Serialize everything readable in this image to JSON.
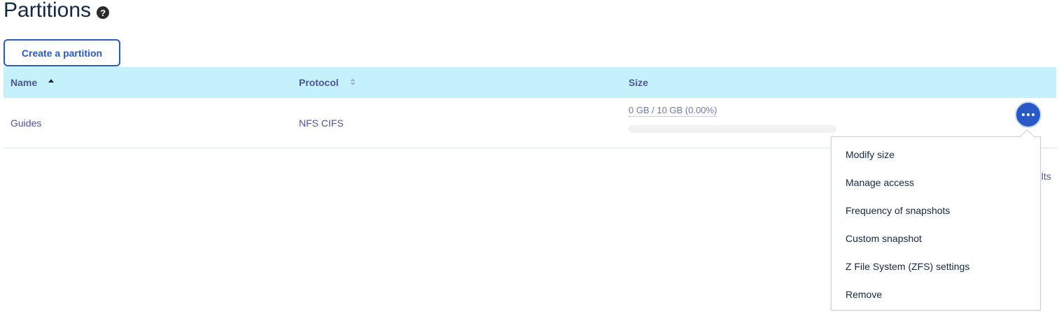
{
  "header": {
    "title": "Partitions",
    "help_icon": "question-circle-icon",
    "create_button": "Create a partition"
  },
  "table": {
    "columns": [
      {
        "label": "Name",
        "sort": "ascending"
      },
      {
        "label": "Protocol",
        "sort": "none"
      },
      {
        "label": "Size",
        "sort": null
      }
    ],
    "rows": [
      {
        "name": "Guides",
        "protocol": "NFS CIFS",
        "size_text": "0 GB / 10 GB (0.00%)",
        "usage_fraction": 0.0
      }
    ],
    "actions_icon": "ellipsis-icon"
  },
  "pagination": {
    "results_fragment": "ults"
  },
  "actions_menu": {
    "items": [
      "Modify size",
      "Manage access",
      "Frequency of snapshots",
      "Custom snapshot",
      "Z File System (ZFS) settings",
      "Remove"
    ]
  },
  "colors": {
    "primary": "#2859c5",
    "header_bg": "#c5f1fd",
    "title": "#122844",
    "text": "#4d5693"
  }
}
